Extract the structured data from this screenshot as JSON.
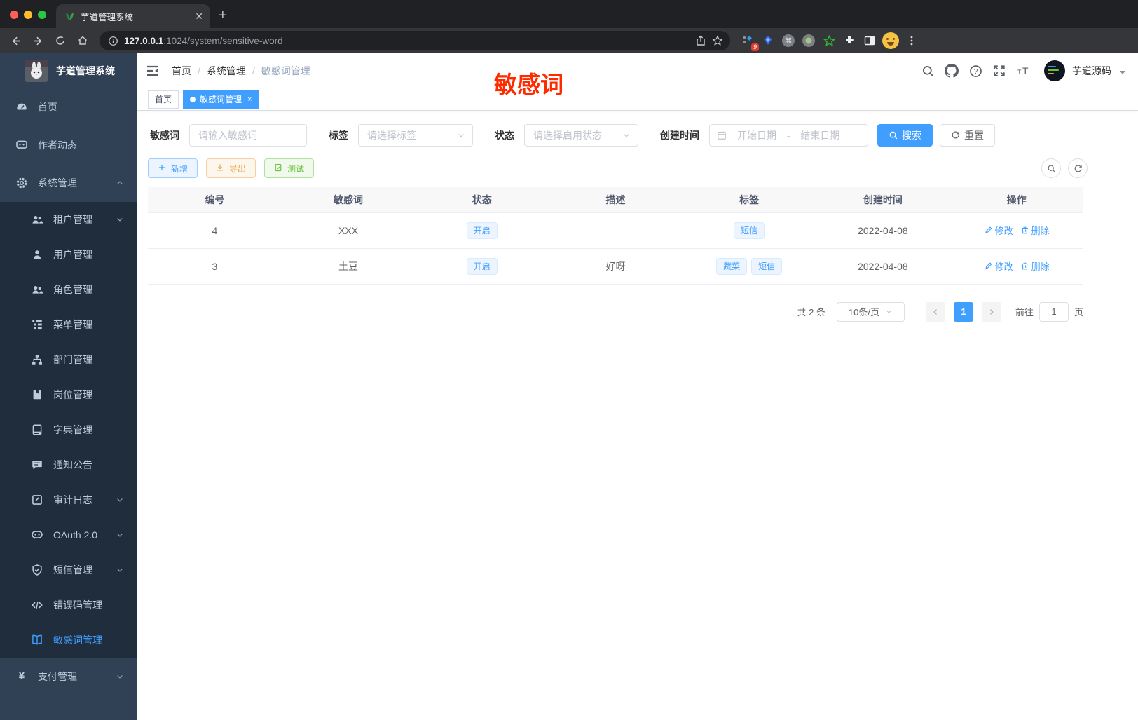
{
  "browser": {
    "tab_title": "芋道管理系统",
    "url_host": "127.0.0.1",
    "url_rest": ":1024/system/sensitive-word",
    "extension_badge": "9"
  },
  "sidebar": {
    "logo_title": "芋道管理系统",
    "items": [
      {
        "label": "首页",
        "icon": "dashboard-icon",
        "type": "top"
      },
      {
        "label": "作者动态",
        "icon": "chat-icon",
        "type": "top"
      },
      {
        "label": "系统管理",
        "icon": "gear-icon",
        "type": "top",
        "chevron": "up"
      },
      {
        "label": "租户管理",
        "icon": "users-icon",
        "type": "sub",
        "chevron": "down"
      },
      {
        "label": "用户管理",
        "icon": "user-icon",
        "type": "sub"
      },
      {
        "label": "角色管理",
        "icon": "user-group-icon",
        "type": "sub"
      },
      {
        "label": "菜单管理",
        "icon": "menu-tree-icon",
        "type": "sub"
      },
      {
        "label": "部门管理",
        "icon": "org-chart-icon",
        "type": "sub"
      },
      {
        "label": "岗位管理",
        "icon": "badge-icon",
        "type": "sub"
      },
      {
        "label": "字典管理",
        "icon": "dictionary-icon",
        "type": "sub"
      },
      {
        "label": "通知公告",
        "icon": "announcement-icon",
        "type": "sub"
      },
      {
        "label": "审计日志",
        "icon": "audit-log-icon",
        "type": "sub",
        "chevron": "down"
      },
      {
        "label": "OAuth 2.0",
        "icon": "oauth-icon",
        "type": "sub",
        "chevron": "down"
      },
      {
        "label": "短信管理",
        "icon": "shield-check-icon",
        "type": "sub",
        "chevron": "down"
      },
      {
        "label": "错误码管理",
        "icon": "code-icon",
        "type": "sub"
      },
      {
        "label": "敏感词管理",
        "icon": "open-book-icon",
        "type": "sub",
        "active": true
      },
      {
        "label": "支付管理",
        "icon": "yen-icon",
        "type": "top",
        "chevron": "down"
      }
    ]
  },
  "header": {
    "breadcrumb": [
      "首页",
      "系统管理",
      "敏感词管理"
    ],
    "annotation": "敏感词",
    "username": "芋道源码"
  },
  "tags_view": [
    {
      "label": "首页",
      "active": false
    },
    {
      "label": "敏感词管理",
      "active": true,
      "closable": true
    }
  ],
  "filters": {
    "keyword_label": "敏感词",
    "keyword_placeholder": "请输入敏感词",
    "tag_label": "标签",
    "tag_placeholder": "请选择标签",
    "status_label": "状态",
    "status_placeholder": "请选择启用状态",
    "date_label": "创建时间",
    "date_start_placeholder": "开始日期",
    "date_separator": "-",
    "date_end_placeholder": "结束日期",
    "search_label": "搜索",
    "reset_label": "重置"
  },
  "toolbar": {
    "add_label": "新增",
    "export_label": "导出",
    "test_label": "测试"
  },
  "table": {
    "columns": [
      "编号",
      "敏感词",
      "状态",
      "描述",
      "标签",
      "创建时间",
      "操作"
    ],
    "edit_label": "修改",
    "delete_label": "删除",
    "rows": [
      {
        "id": "4",
        "word": "XXX",
        "status": "开启",
        "description": "",
        "tags": [
          "短信"
        ],
        "create_time": "2022-04-08"
      },
      {
        "id": "3",
        "word": "土豆",
        "status": "开启",
        "description": "好呀",
        "tags": [
          "蔬菜",
          "短信"
        ],
        "create_time": "2022-04-08"
      }
    ]
  },
  "pagination": {
    "total_text": "共 2 条",
    "page_size": "10条/页",
    "current_page": "1",
    "goto_label": "前往",
    "goto_value": "1",
    "page_label": "页"
  },
  "icons": {
    "navbar": [
      "search-icon",
      "github-icon",
      "help-icon",
      "fullscreen-icon",
      "font-size-icon",
      "caret-down-icon"
    ],
    "browser": [
      "back-icon",
      "forward-icon",
      "reload-icon",
      "home-icon",
      "info-icon",
      "share-icon",
      "star-icon",
      "extensions",
      "more-vertical-icon"
    ]
  },
  "colors": {
    "accent": "#409eff",
    "sidebar_bg": "#304156",
    "submenu_bg": "#1f2d3d",
    "annotation_red": "#ff2b00",
    "warning": "#e6a23c",
    "success": "#67c23a",
    "tag_bg": "#ecf5ff",
    "table_header_bg": "#f8f8f9"
  }
}
